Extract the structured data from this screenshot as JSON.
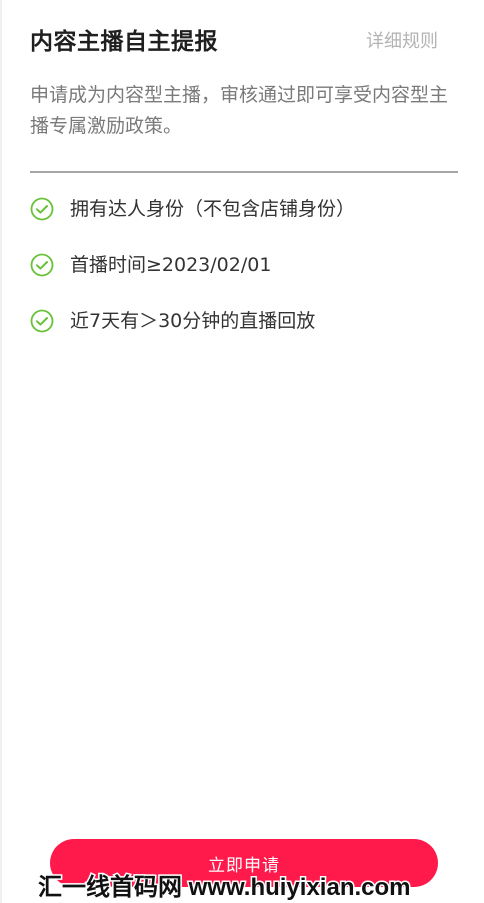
{
  "header": {
    "title": "内容主播自主提报",
    "rules_link": "详细规则"
  },
  "description": "申请成为内容型主播，审核通过即可享受内容型主播专属激励政策。",
  "requirements": [
    {
      "text": "拥有达人身份（不包含店铺身份）",
      "icon": "check-circle-icon",
      "status": "met"
    },
    {
      "text": "首播时间≥2023/02/01",
      "icon": "check-circle-icon",
      "status": "met"
    },
    {
      "text": "近7天有＞30分钟的直播回放",
      "icon": "check-circle-icon",
      "status": "met"
    }
  ],
  "apply_button": {
    "label": "立即申请"
  },
  "watermark": "汇一线首码网 www.huiyixian.com",
  "colors": {
    "accent": "#ff1a4b",
    "check": "#67c23a",
    "muted_text": "#b3b3b3"
  }
}
